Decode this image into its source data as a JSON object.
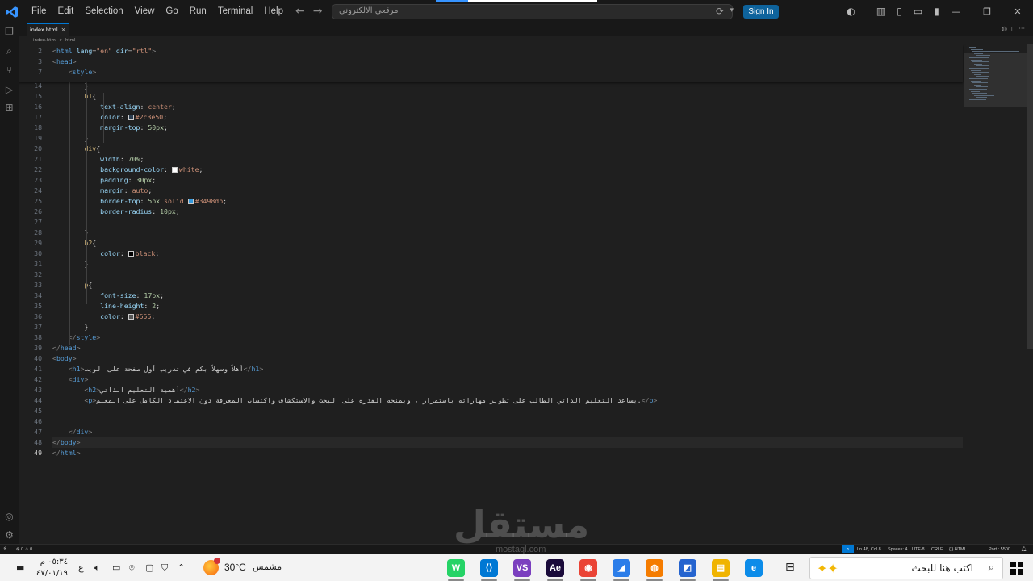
{
  "menu": [
    "File",
    "Edit",
    "Selection",
    "View",
    "Go",
    "Run",
    "Terminal",
    "Help"
  ],
  "command_center": {
    "text": "مرقعي الالكتروني"
  },
  "signin_label": "Sign In",
  "tab": {
    "label": "index.html",
    "close": "×"
  },
  "breadcrumb": [
    "index.html",
    ">",
    "html"
  ],
  "code_lines": [
    {
      "n": "2",
      "html": "<span class='t-punct'>&lt;</span><span class='t-tag'>html</span> <span class='t-attr'>lang</span><span class='t-text'>=</span><span class='t-str'>\"en\"</span> <span class='t-attr'>dir</span><span class='t-text'>=</span><span class='t-str'>\"rtl\"</span><span class='t-punct'>&gt;</span>"
    },
    {
      "n": "3",
      "html": "<span class='t-punct'>&lt;</span><span class='t-tag'>head</span><span class='t-punct'>&gt;</span>"
    },
    {
      "n": "7",
      "html": "    <span class='t-punct'>&lt;</span><span class='t-tag'>style</span><span class='t-punct'>&gt;</span>"
    },
    {
      "n": "14",
      "html": "        <span class='t-text'>}</span>"
    },
    {
      "n": "15",
      "html": "        <span class='t-sel'>h1</span><span class='t-text'>{</span>"
    },
    {
      "n": "16",
      "html": "            <span class='t-prop'>text-align</span><span class='t-text'>: </span><span class='t-val'>center</span><span class='t-text'>;</span>"
    },
    {
      "n": "17",
      "html": "            <span class='t-prop'>color</span><span class='t-text'>: </span><span class='swatch' style='background:#2c3e50'></span><span class='t-val'>#2c3e50</span><span class='t-text'>;</span>"
    },
    {
      "n": "18",
      "html": "            <span class='t-prop'>margin-top</span><span class='t-text'>: </span><span class='t-num'>50px</span><span class='t-text'>;</span>"
    },
    {
      "n": "19",
      "html": "        <span class='t-text'>}</span>"
    },
    {
      "n": "20",
      "html": "        <span class='t-sel'>div</span><span class='t-text'>{</span>"
    },
    {
      "n": "21",
      "html": "            <span class='t-prop'>width</span><span class='t-text'>: </span><span class='t-num'>70%</span><span class='t-text'>;</span>"
    },
    {
      "n": "22",
      "html": "            <span class='t-prop'>background-color</span><span class='t-text'>: </span><span class='swatch' style='background:#ffffff'></span><span class='t-val'>white</span><span class='t-text'>;</span>"
    },
    {
      "n": "23",
      "html": "            <span class='t-prop'>padding</span><span class='t-text'>: </span><span class='t-num'>30px</span><span class='t-text'>;</span>"
    },
    {
      "n": "24",
      "html": "            <span class='t-prop'>margin</span><span class='t-text'>: </span><span class='t-val'>auto</span><span class='t-text'>;</span>"
    },
    {
      "n": "25",
      "html": "            <span class='t-prop'>border-top</span><span class='t-text'>: </span><span class='t-num'>5px</span> <span class='t-val'>solid</span> <span class='swatch' style='background:#3498db'></span><span class='t-val'>#3498db</span><span class='t-text'>;</span>"
    },
    {
      "n": "26",
      "html": "            <span class='t-prop'>border-radius</span><span class='t-text'>: </span><span class='t-num'>10px</span><span class='t-text'>;</span>"
    },
    {
      "n": "27",
      "html": ""
    },
    {
      "n": "28",
      "html": "        <span class='t-text'>}</span>"
    },
    {
      "n": "29",
      "html": "        <span class='t-sel'>h2</span><span class='t-text'>{</span>"
    },
    {
      "n": "30",
      "html": "            <span class='t-prop'>color</span><span class='t-text'>: </span><span class='swatch' style='background:#000000'></span><span class='t-val'>black</span><span class='t-text'>;</span>"
    },
    {
      "n": "31",
      "html": "        <span class='t-text'>}</span>"
    },
    {
      "n": "32",
      "html": ""
    },
    {
      "n": "33",
      "html": "        <span class='t-sel'>p</span><span class='t-text'>{</span>"
    },
    {
      "n": "34",
      "html": "            <span class='t-prop'>font-size</span><span class='t-text'>: </span><span class='t-num'>17px</span><span class='t-text'>;</span>"
    },
    {
      "n": "35",
      "html": "            <span class='t-prop'>line-height</span><span class='t-text'>: </span><span class='t-num'>2</span><span class='t-text'>;</span>"
    },
    {
      "n": "36",
      "html": "            <span class='t-prop'>color</span><span class='t-text'>: </span><span class='swatch' style='background:#555555'></span><span class='t-val'>#555</span><span class='t-text'>;</span>"
    },
    {
      "n": "37",
      "html": "        <span class='t-text'>}</span>"
    },
    {
      "n": "38",
      "html": "    <span class='t-punct'>&lt;/</span><span class='t-tag'>style</span><span class='t-punct'>&gt;</span>"
    },
    {
      "n": "39",
      "html": "<span class='t-punct'>&lt;/</span><span class='t-tag'>head</span><span class='t-punct'>&gt;</span>"
    },
    {
      "n": "40",
      "html": "<span class='t-punct'>&lt;</span><span class='t-tag'>body</span><span class='t-punct'>&gt;</span>"
    },
    {
      "n": "41",
      "html": "    <span class='t-punct'>&lt;</span><span class='t-tag'>h1</span><span class='t-punct'>&gt;</span><span class='t-text'>أهلاً وسهلاً بكم في تدريب أول صفحة على الويب</span><span class='t-punct'>&lt;/</span><span class='t-tag'>h1</span><span class='t-punct'>&gt;</span>"
    },
    {
      "n": "42",
      "html": "    <span class='t-punct'>&lt;</span><span class='t-tag'>div</span><span class='t-punct'>&gt;</span>"
    },
    {
      "n": "43",
      "html": "        <span class='t-punct'>&lt;</span><span class='t-tag'>h2</span><span class='t-punct'>&gt;</span><span class='t-text'>أهمية التعليم الذاتي</span><span class='t-punct'>&lt;/</span><span class='t-tag'>h2</span><span class='t-punct'>&gt;</span>"
    },
    {
      "n": "44",
      "html": "        <span class='t-punct'>&lt;</span><span class='t-tag'>p</span><span class='t-punct'>&gt;</span><span class='t-text'>يساعد التعليم الذاتي الطالب على تطوير مهاراته باستمرار ، ويمنحه القدرة على البحث والاستكشاف واكتساب المعرفة دون الاعتماد الكامل على المعلم.</span><span class='t-punct'>&lt;/</span><span class='t-tag'>p</span><span class='t-punct'>&gt;</span>"
    },
    {
      "n": "45",
      "html": ""
    },
    {
      "n": "46",
      "html": ""
    },
    {
      "n": "47",
      "html": "    <span class='t-punct'>&lt;/</span><span class='t-tag'>div</span><span class='t-punct'>&gt;</span>"
    },
    {
      "n": "48",
      "html": "<span class='t-punct'>&lt;/</span><span class='t-tag'>body</span><span class='t-punct'>&gt;</span>"
    },
    {
      "n": "49",
      "html": "<span class='t-punct'>&lt;/</span><span class='t-tag'>html</span><span class='t-punct'>&gt;</span>"
    }
  ],
  "status": {
    "errors": "⊗ 0 ⚠ 0",
    "cursor": "Ln 48, Col 8",
    "spaces": "Spaces: 4",
    "encoding": "UTF-8",
    "eol": "CRLF",
    "language": "{ } HTML",
    "port": "Port : 5500"
  },
  "taskbar": {
    "search_placeholder": "اكتب هنا للبحث",
    "temperature": "30°C",
    "condition": "مشمس",
    "time": "٠٥:٣٤ م",
    "date": "٤٧/٠١/١٩",
    "lang": "ع",
    "apps": [
      {
        "label": "W",
        "color": "#25d366"
      },
      {
        "label": "⟨⟩",
        "color": "#0078d4"
      },
      {
        "label": "VS",
        "color": "#7b3fbf"
      },
      {
        "label": "Ae",
        "color": "#1a0a3a"
      },
      {
        "label": "◉",
        "color": "#ea4335"
      },
      {
        "label": "◢",
        "color": "#2b7de9"
      },
      {
        "label": "◍",
        "color": "#f57c00"
      },
      {
        "label": "◩",
        "color": "#2564cf"
      },
      {
        "label": "▤",
        "color": "#f0b400"
      },
      {
        "label": "e",
        "color": "#0c8ce9"
      }
    ]
  },
  "watermark": {
    "text": "مستقل",
    "sub": "mostaql.com"
  }
}
